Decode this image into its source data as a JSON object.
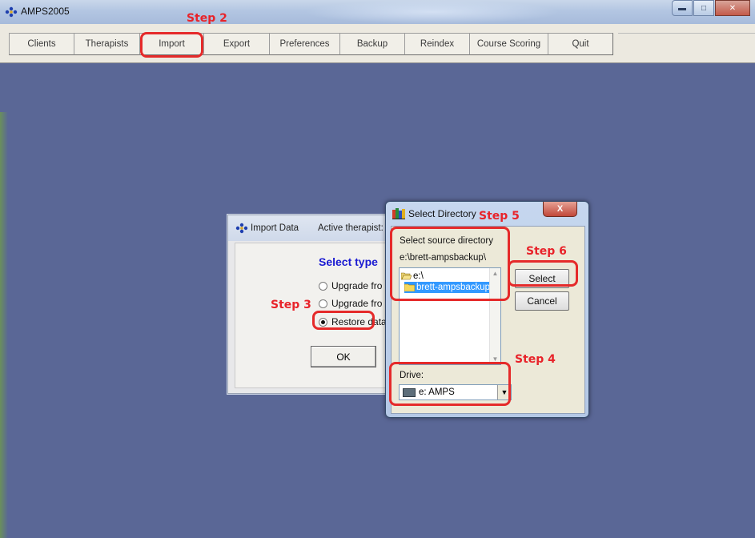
{
  "window": {
    "title": "AMPS2005",
    "controls": [
      "minimize-icon",
      "maximize-icon",
      "close-icon"
    ]
  },
  "menu": [
    {
      "label": "Clients"
    },
    {
      "label": "Therapists"
    },
    {
      "label": "Import"
    },
    {
      "label": "Export"
    },
    {
      "label": "Preferences"
    },
    {
      "label": "Backup"
    },
    {
      "label": "Reindex"
    },
    {
      "label": "Course Scoring"
    },
    {
      "label": "Quit"
    }
  ],
  "import_dialog": {
    "title": "Import Data",
    "active_therapist": "Active therapist:",
    "heading": "Select type",
    "options": [
      {
        "label": "Upgrade fro",
        "selected": false
      },
      {
        "label": "Upgrade fro",
        "selected": false
      },
      {
        "label": "Restore data",
        "selected": true
      }
    ],
    "ok_label": "OK"
  },
  "select_dialog": {
    "title": "Select Directory",
    "close_label": "X",
    "source_label": "Select source directory",
    "current_path": "e:\\brett-ampsbackup\\",
    "directories": [
      {
        "name": "e:\\",
        "selected": false
      },
      {
        "name": "brett-ampsbackup",
        "selected": true
      }
    ],
    "select_label": "Select",
    "cancel_label": "Cancel",
    "drive_label": "Drive:",
    "drive_value": "e: AMPS"
  },
  "annotations": {
    "step2": "Step 2",
    "step3": "Step 3",
    "step4": "Step 4",
    "step5": "Step 5",
    "step6": "Step 6",
    "color": "#e8232a"
  }
}
